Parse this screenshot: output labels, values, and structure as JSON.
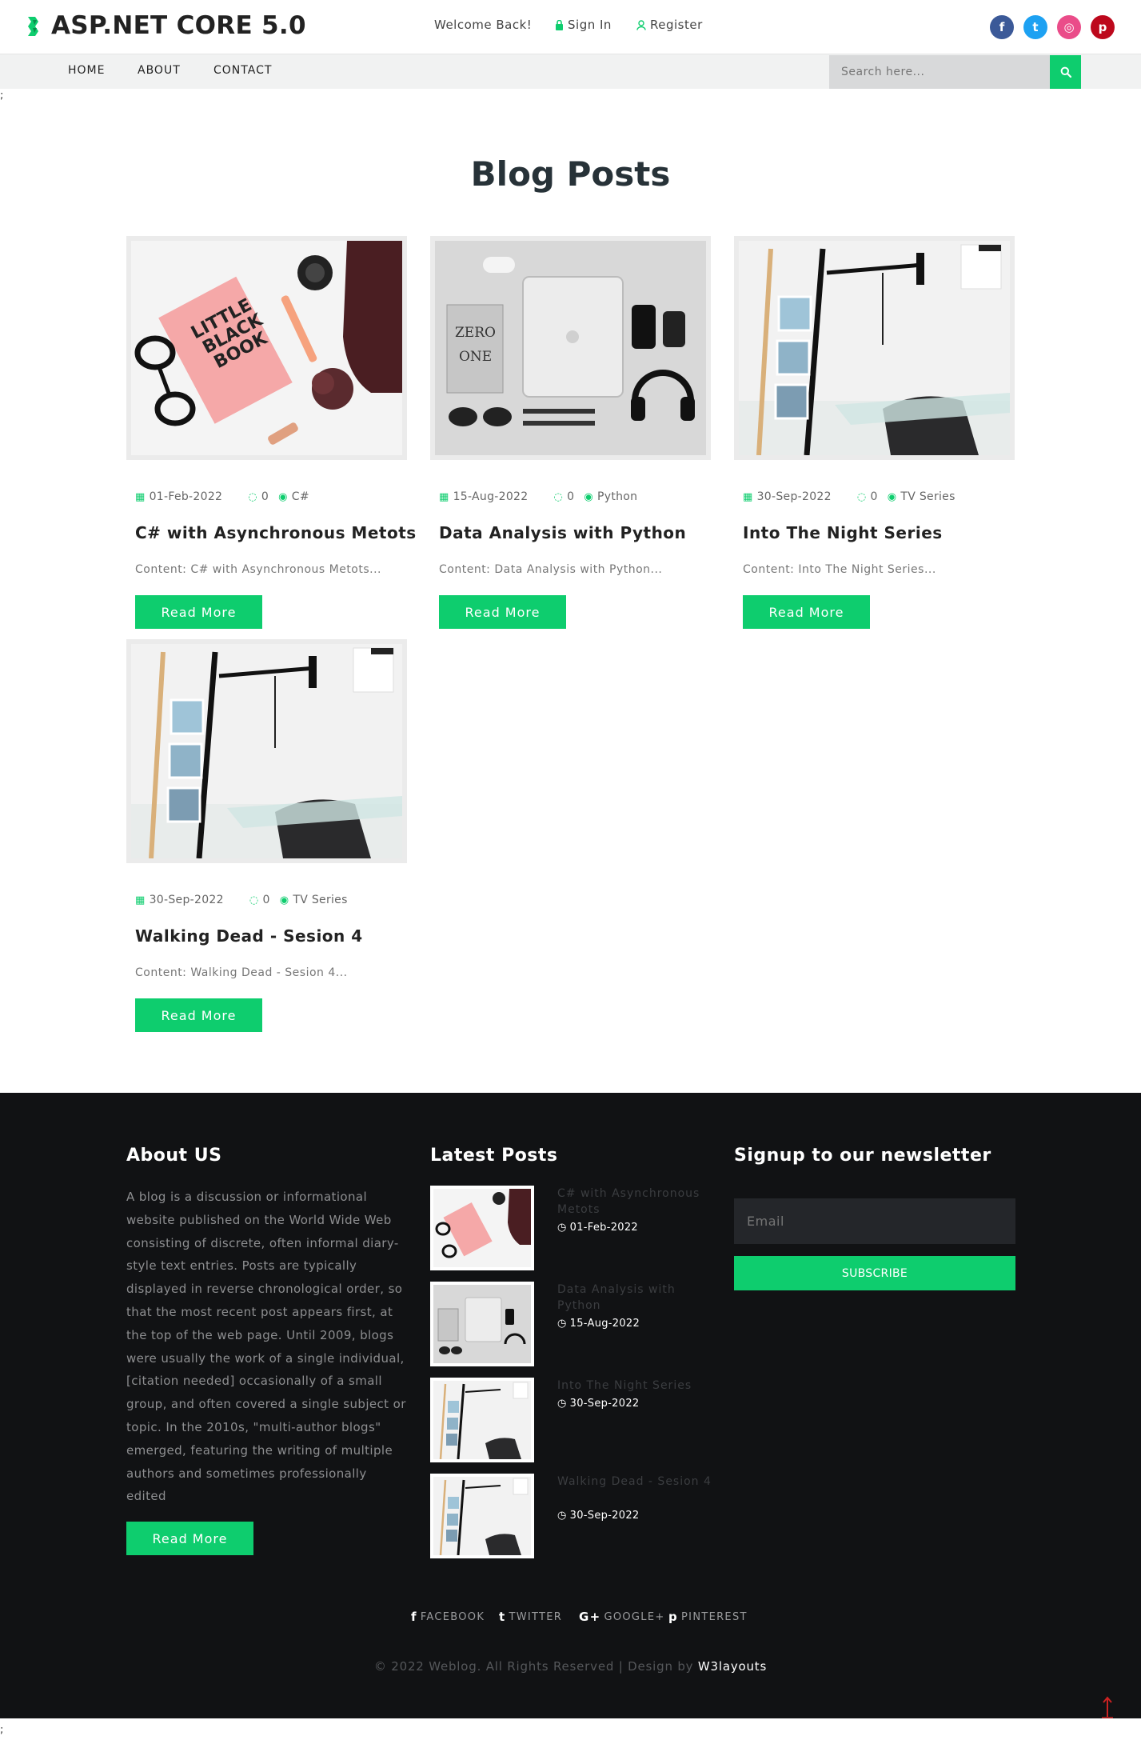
{
  "header": {
    "brand": "ASP.NET CORE 5.0",
    "welcome": "Welcome Back!",
    "signin": "Sign In",
    "register": "Register",
    "social": [
      {
        "name": "facebook",
        "glyph": "f",
        "color": "#3b5998"
      },
      {
        "name": "twitter",
        "glyph": "t",
        "color": "#1da1f2"
      },
      {
        "name": "dribbble",
        "glyph": "◎",
        "color": "#ea4c89"
      },
      {
        "name": "pinterest",
        "glyph": "p",
        "color": "#bd081c"
      }
    ]
  },
  "nav": {
    "items": [
      "HOME",
      "ABOUT",
      "CONTACT"
    ],
    "search_placeholder": "Search here..."
  },
  "stray": ";",
  "blog": {
    "title": "Blog Posts",
    "read_more": "Read More",
    "posts": [
      {
        "date": "01-Feb-2022",
        "comments": "0",
        "category": "C#",
        "title": "C# with Asynchronous Metots",
        "content": "Content: C# with Asynchronous Metots...",
        "image": "book-flatlay"
      },
      {
        "date": "15-Aug-2022",
        "comments": "0",
        "category": "Python",
        "title": "Data Analysis with Python",
        "content": "Content: Data Analysis with Python...",
        "image": "laptop-flatlay"
      },
      {
        "date": "30-Sep-2022",
        "comments": "0",
        "category": "TV Series",
        "title": "Into The Night Series",
        "content": "Content: Into The Night Series...",
        "image": "ladder-shelf"
      },
      {
        "date": "30-Sep-2022",
        "comments": "0",
        "category": "TV Series",
        "title": "Walking Dead - Sesion 4",
        "content": "Content: Walking Dead - Sesion 4...",
        "image": "ladder-shelf"
      }
    ]
  },
  "footer": {
    "about_title": "About US",
    "about_text": "A blog is a discussion or informational website published on the World Wide Web consisting of discrete, often informal diary-style text entries. Posts are typically displayed in reverse chronological order, so that the most recent post appears first, at the top of the web page. Until 2009, blogs were usually the work of a single individual,[citation needed] occasionally of a small group, and often covered a single subject or topic. In the 2010s, \"multi-author blogs\" emerged, featuring the writing of multiple authors and sometimes professionally edited",
    "about_button": "Read More",
    "latest_title": "Latest Posts",
    "latest": [
      {
        "title": "C# with Asynchronous Metots",
        "date": "01-Feb-2022"
      },
      {
        "title": "Data Analysis with Python",
        "date": "15-Aug-2022"
      },
      {
        "title": "Into The Night Series",
        "date": "30-Sep-2022"
      },
      {
        "title": "Walking Dead - Sesion 4",
        "date": "30-Sep-2022"
      }
    ],
    "newsletter_title": "Signup to our newsletter",
    "email_placeholder": "Email",
    "subscribe": "SUBSCRIBE",
    "social": [
      {
        "glyph": "f",
        "label": "FACEBOOK"
      },
      {
        "glyph": "t",
        "label": "TWITTER"
      },
      {
        "glyph": "G+",
        "label": "GOOGLE+"
      },
      {
        "glyph": "p",
        "label": "PINTEREST"
      }
    ],
    "copyright": "© 2022 Weblog. All Rights Reserved | Design by",
    "designer": "W3layouts"
  },
  "colors": {
    "accent": "#0ecd6e",
    "heading": "#273238",
    "footer_bg": "#111214"
  }
}
